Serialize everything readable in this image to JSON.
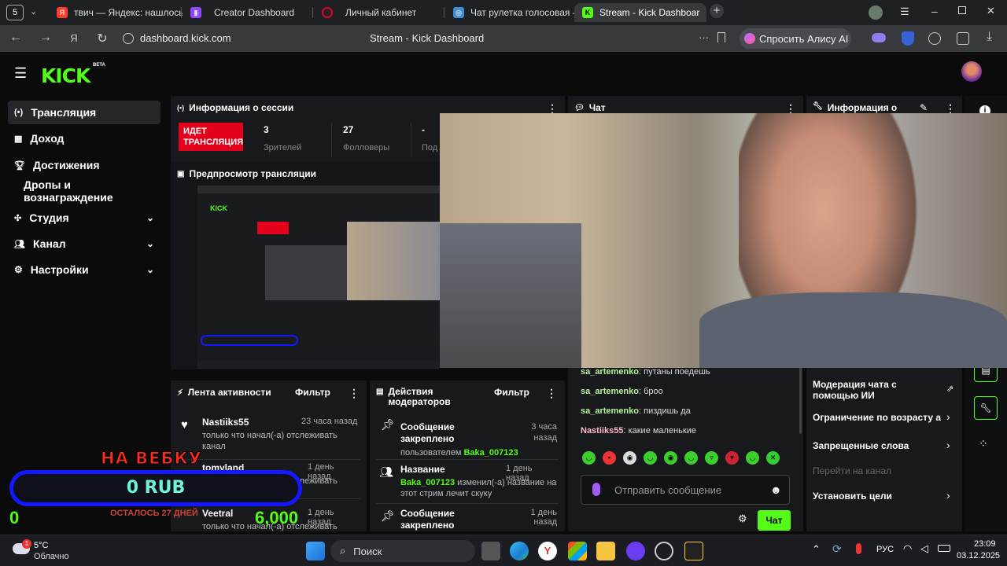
{
  "browser": {
    "tab_count_badge": "5",
    "tabs": [
      {
        "label": "твич — Яндекс: нашлось",
        "icon": "yandex-icon",
        "color": "#ff3b30"
      },
      {
        "label": "Creator Dashboard",
        "icon": "twitch-icon",
        "color": "#9146ff"
      },
      {
        "label": "Личный кабинет",
        "icon": "circle-icon",
        "color": "#e3001b"
      },
      {
        "label": "Чат рулетка голосовая —",
        "icon": "chat-roulette-icon",
        "color": "#3a8fd6"
      },
      {
        "label": "Stream - Kick Dashboar",
        "icon": "kick-icon",
        "color": "#53fc18",
        "active": true
      }
    ],
    "url": "dashboard.kick.com",
    "page_title": "Stream - Kick Dashboard",
    "alice_label": "Спросить Алису AI"
  },
  "app": {
    "logo": "KICK",
    "beta": "BETA",
    "sidebar": [
      {
        "label": "Трансляция",
        "icon": "broadcast-icon",
        "selected": true
      },
      {
        "label": "Доход",
        "icon": "income-icon"
      },
      {
        "label": "Достижения",
        "icon": "trophy-icon"
      },
      {
        "label": "Дропы и вознаграждение"
      },
      {
        "label": "Студия",
        "icon": "studio-icon",
        "expandable": true
      },
      {
        "label": "Канал",
        "icon": "channel-icon",
        "expandable": true
      },
      {
        "label": "Настройки",
        "icon": "gear-icon",
        "expandable": true
      }
    ],
    "session": {
      "title": "Информация о сессии",
      "live_badge": "ИДЕТ ТРАНСЛЯЦИЯ",
      "stats": [
        {
          "value": "3",
          "label": "Зрителей"
        },
        {
          "value": "27",
          "label": "Фолловеры"
        },
        {
          "value": "-",
          "label": "Подписчики"
        }
      ]
    },
    "chat": {
      "title": "Чат",
      "messages": [
        {
          "user": "sa_artemenko",
          "text": "путаны поедешь"
        },
        {
          "user": "sa_artemenko",
          "text": "броо"
        },
        {
          "user": "sa_artemenko",
          "text": "пиздишь да"
        },
        {
          "user": "Nastiiks55",
          "text": "какие маленькие"
        }
      ],
      "input_placeholder": "Отправить сообщение",
      "send_label": "Чат"
    },
    "stream_info": {
      "title": "Информация о трансляции",
      "items": [
        {
          "label": "Модерация чата с помощью ИИ",
          "icon": "external-link-icon"
        },
        {
          "label": "Ограничение по возрасту аудитории",
          "icon": "chevron-right-icon"
        },
        {
          "label": "Запрещенные слова",
          "icon": "chevron-right-icon"
        },
        {
          "label": "Перейти на канал",
          "disabled": true
        },
        {
          "label": "Установить цели",
          "icon": "chevron-right-icon"
        }
      ]
    },
    "preview": {
      "title": "Предпросмотр трансляции"
    },
    "activity": {
      "title": "Лента активности",
      "filter": "Фильтр",
      "items": [
        {
          "name": "Nastiiks55",
          "time": "23 часа назад",
          "desc": "только что начал(-а) отслеживать канал"
        },
        {
          "name": "tomyland",
          "time": "1 день назад",
          "desc": "только что начал(-а) отслеживать канал"
        },
        {
          "name": "Veetral",
          "time": "1 день назад",
          "desc": "только что начал(-а) отслеживать канал"
        }
      ]
    },
    "mod_actions": {
      "title": "Действия модераторов",
      "filter": "Фильтр",
      "items": [
        {
          "name": "Сообщение закреплено",
          "time": "3 часа назад",
          "desc": "пользователем ",
          "user": "Baka_007123",
          "desc2": ""
        },
        {
          "name": "Название",
          "time": "1 день назад",
          "desc": "",
          "user": "Baka_007123",
          "desc2": " изменил(-а) название на этот стрим лечит скуку"
        },
        {
          "name": "Сообщение закреплено",
          "time": "1 день назад",
          "desc": "",
          "user": "",
          "desc2": ""
        }
      ]
    },
    "widget": {
      "headline": "НА ВЕБКУ",
      "amount": "0 RUB",
      "remaining": "ОСТАЛОСЬ 27 ДНЕЙ",
      "min": "0",
      "goal": "6,000"
    }
  },
  "taskbar": {
    "weather_temp": "5°C",
    "weather_desc": "Облачно",
    "weather_badge": "1",
    "search_label": "Поиск",
    "lang": "РУС",
    "time": "23:09",
    "date": "03.12.2025"
  }
}
